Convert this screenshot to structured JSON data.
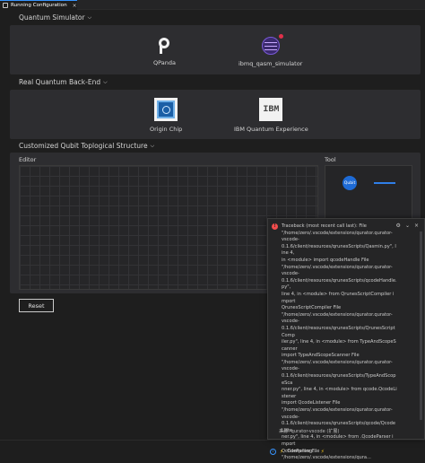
{
  "tab": {
    "label": "Running Configuration",
    "close": "×"
  },
  "sections": {
    "quantum_simulator": {
      "title": "Quantum Simulator",
      "items": [
        {
          "label": "QPanda",
          "icon": "qpanda-logo-icon"
        },
        {
          "label": "ibmq_qasm_simulator",
          "icon": "ibmq-globe-icon"
        }
      ]
    },
    "real_backend": {
      "title": "Real Quantum Back-End",
      "items": [
        {
          "label": "Origin Chip",
          "icon": "origin-chip-icon"
        },
        {
          "label": "IBM Quantum Experience",
          "icon": "ibm-logo-icon",
          "logo_text": "IBM"
        }
      ]
    },
    "topology": {
      "title": "Customized Qubit Toplogical Structure",
      "editor_label": "Editor",
      "tool_label": "Tool",
      "qubit_tool": "Qubit"
    }
  },
  "reset_label": "Reset",
  "notification": {
    "lines": [
      "Traceback (most recent call last): File",
      "\"/home/zero/.vscode/extensions/qurator.qurator-",
      "vscode-",
      "0.1.6/client/resources/qrunesScripts/Qasmin.py\", line 4,",
      "in <module> import qcodeHandle File",
      "\"/home/zero/.vscode/extensions/qurator.qurator-",
      "vscode-",
      "0.1.6/client/resources/qrunesScripts/qcodeHandle.py\",",
      "line 4, in <module> from QrunesScriptCompiler import",
      "QrunesScriptCompiler File",
      "\"/home/zero/.vscode/extensions/qurator.qurator-",
      "vscode-",
      "0.1.6/client/resources/qrunesScripts/QrunesScriptComp",
      "iler.py\", line 4, in <module> from TypeAndScopeScanner",
      "import TypeAndScopeScanner File",
      "\"/home/zero/.vscode/extensions/qurator.qurator-",
      "vscode-",
      "0.1.6/client/resources/qrunesScripts/TypeAndScopeSca",
      "nner.py\", line 4, in <module> from qcode.QcodeListener",
      "import QcodeListener File",
      "\"/home/zero/.vscode/extensions/qurator.qurator-",
      "vscode-",
      "0.1.6/client/resources/qrunesScripts/qcode/QcodeListe",
      "ner.py\", line 4, in <module> from .QcodeParser import",
      "QcodeParser File",
      "\"/home/zero/.vscode/extensions/qura..."
    ],
    "source": "来源: qurator-vscode (扩展)",
    "actions": {
      "settings": "⚙",
      "collapse": "⌄",
      "close": "×"
    }
  },
  "status": {
    "info": "i",
    "text": "Compiling..."
  }
}
